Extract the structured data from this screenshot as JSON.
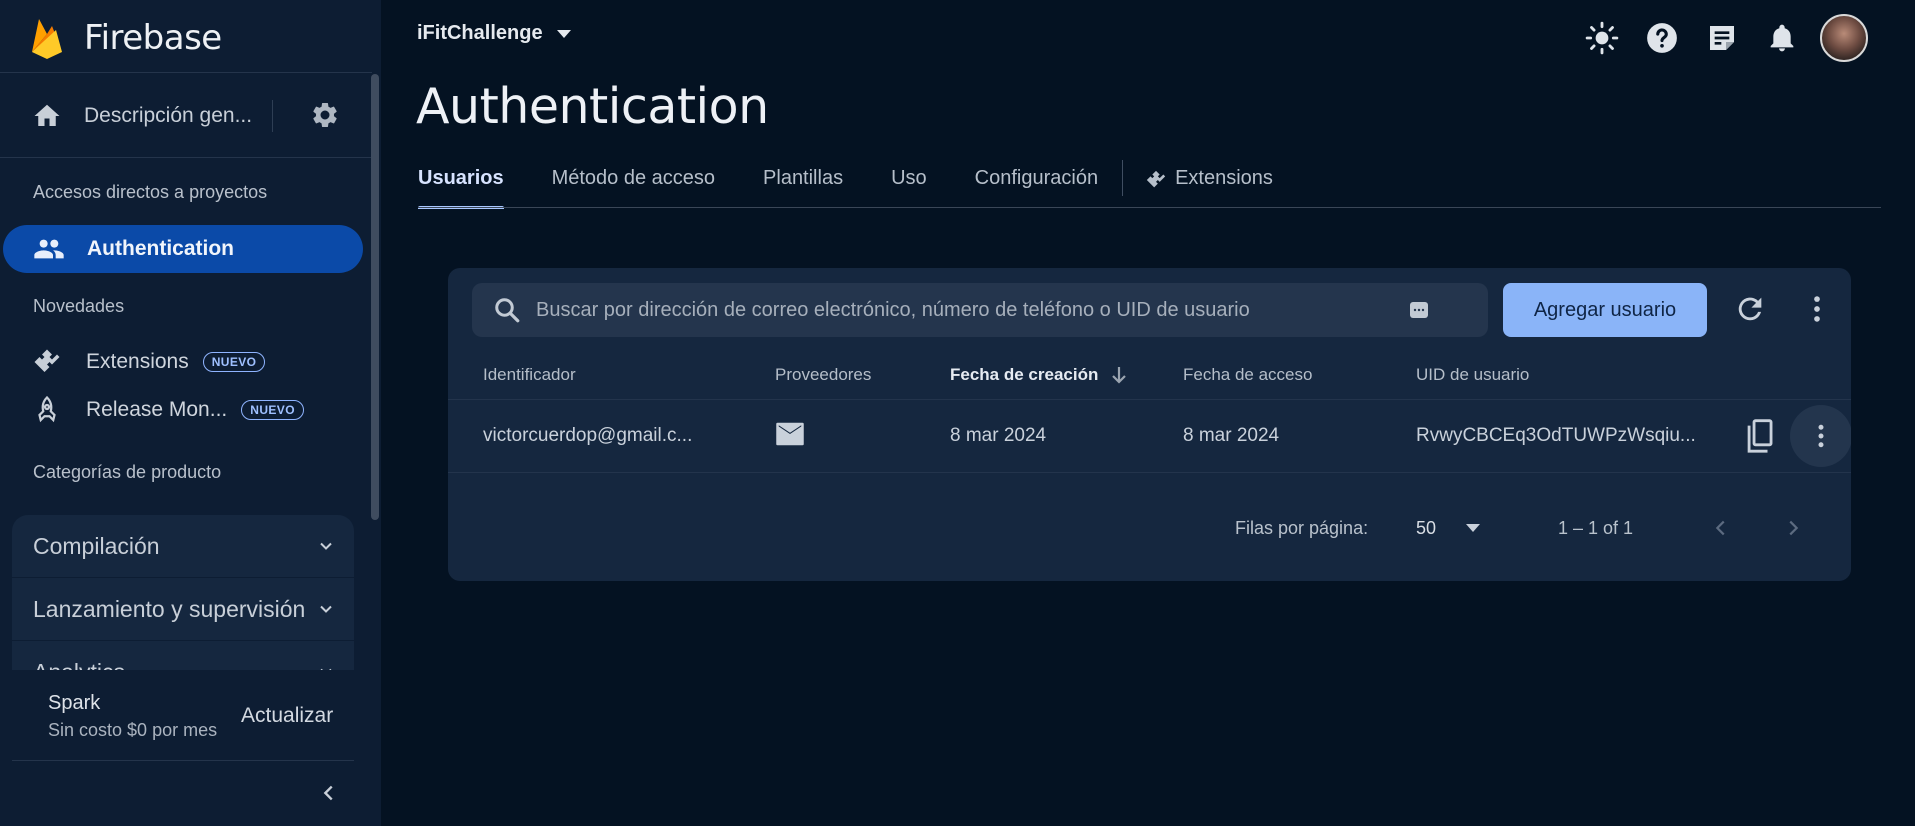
{
  "sidebar": {
    "brand": "Firebase",
    "overview_label": "Descripción gen...",
    "shortcuts_title": "Accesos directos a proyectos",
    "active_item": "Authentication",
    "news_title": "Novedades",
    "news_items": [
      {
        "label": "Extensions",
        "badge": "NUEVO"
      },
      {
        "label": "Release Mon...",
        "badge": "NUEVO"
      }
    ],
    "categories_title": "Categorías de producto",
    "categories": [
      "Compilación",
      "Lanzamiento y supervisión",
      "Analytics"
    ],
    "plan": {
      "name": "Spark",
      "price": "Sin costo $0 por mes",
      "upgrade": "Actualizar"
    }
  },
  "header": {
    "project": "iFitChallenge",
    "icons": [
      "theme-icon",
      "help-icon",
      "notes-icon",
      "notifications-icon"
    ]
  },
  "page": {
    "title": "Authentication",
    "tabs": [
      "Usuarios",
      "Método de acceso",
      "Plantillas",
      "Uso",
      "Configuración",
      "Extensions"
    ],
    "active_tab": "Usuarios"
  },
  "users": {
    "search_placeholder": "Buscar por dirección de correo electrónico, número de teléfono o UID de usuario",
    "add_button": "Agregar usuario",
    "columns": [
      "Identificador",
      "Proveedores",
      "Fecha de creación",
      "Fecha de acceso",
      "UID de usuario"
    ],
    "sorted_column": "Fecha de creación",
    "rows": [
      {
        "identifier": "victorcuerdop@gmail.c...",
        "provider": "email",
        "created": "8 mar 2024",
        "last_access": "8 mar 2024",
        "uid": "RvwyCBCEq3OdTUWPzWsqiu..."
      }
    ],
    "pagination": {
      "rows_label": "Filas por página:",
      "rows_value": "50",
      "range": "1 – 1 of 1"
    }
  },
  "colors": {
    "accent": "#8ab4f8",
    "active_nav": "#0b4aa8",
    "background": "#041222"
  }
}
